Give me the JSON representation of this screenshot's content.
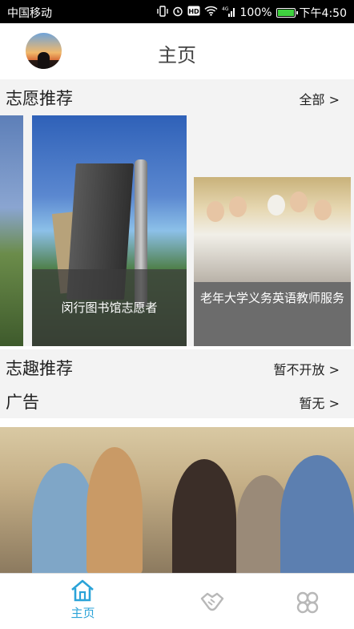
{
  "status_bar": {
    "carrier": "中国移动",
    "icons": [
      "vibrate-icon",
      "alarm-icon",
      "hd-icon",
      "wifi-icon",
      "signal-icon"
    ],
    "signal_label": "4G",
    "battery": "100%",
    "time": "下午4:50"
  },
  "header": {
    "title": "主页",
    "avatar": "avatar"
  },
  "volunteer_section": {
    "title": "志愿推荐",
    "more": "全部 >",
    "cards": [
      {
        "caption": ""
      },
      {
        "caption": "闵行图书馆志愿者"
      },
      {
        "caption": "老年大学义务英语教师服务"
      }
    ]
  },
  "interest_section": {
    "title": "志趣推荐",
    "more": "暂不开放 >"
  },
  "ad_section": {
    "title": "广告",
    "more": "暂无 >"
  },
  "bottom_nav": {
    "items": [
      {
        "label": "主页",
        "icon": "home-icon",
        "active": true
      },
      {
        "label": "",
        "icon": "handshake-icon",
        "active": false
      },
      {
        "label": "",
        "icon": "grid-icon",
        "active": false
      }
    ]
  },
  "colors": {
    "accent": "#2ba3d8",
    "section_bg": "#f3f3f3",
    "inactive_icon": "#b8b8b8"
  }
}
